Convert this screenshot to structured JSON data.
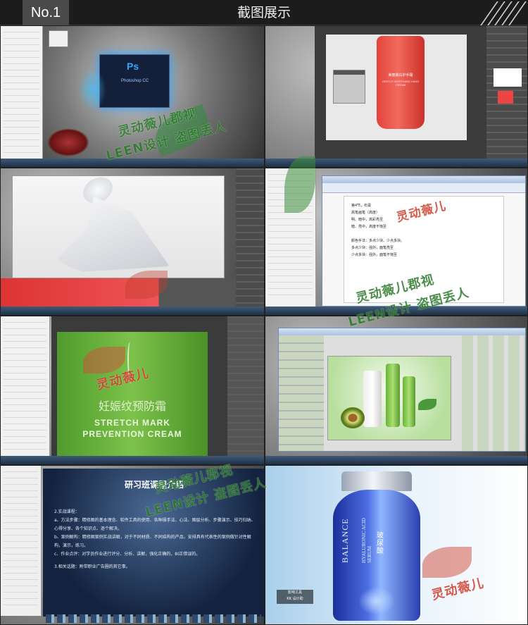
{
  "header": {
    "number_label": "No.1",
    "title": "截图展示"
  },
  "watermark": {
    "line1": "灵动薇儿郡视",
    "line2": "LEEN设计 盗图丢人",
    "short": "灵动薇儿"
  },
  "panels": {
    "ps_splash": {
      "logo": "Ps",
      "product": "Photoshop CC"
    },
    "tube": {
      "text_cn": "美丽嫩白护手霜",
      "text_en": "GENTLE WHITENING HAND CREAM"
    },
    "document": {
      "lines": [
        "第4节，石膏",
        "高笔画笔（高度）",
        "明、暗中，高彩亮至",
        "暗、亮中，高度不饱至",
        "",
        "颜色手法：多点少块、少点多块。",
        "多点少块：强外，面笔亮至",
        "少点多块：强外，面笔不饱至"
      ]
    },
    "green_bottle": {
      "text_cn": "妊娠纹预防霜",
      "text_en_1": "STRETCH MARK",
      "text_en_2": "PREVENTION CREAM"
    },
    "slide": {
      "title": "研习班课程介绍",
      "items": [
        "2.实战课程：",
        "a、方法步骤：精修图的基本理念、软件工具的使用、各种操手法、心法、图层分析、步骤演示、技巧归纳、心得分享、各个知识点、逐个解决。",
        "b、案例解构：精修图案例实战讲解，对于不同材质、不同结构的产品，安排具有代表性的案例做针对性解构，演示，练习。",
        "c、作业点评：对学员作业进行评分、分析、讲解，强化正确的，纠正错误的。",
        "3.相关话题：附带职业广告圈的其它事。"
      ]
    },
    "serum": {
      "brand": "BALANCE",
      "text_en": "HYALURONIC ACID SERUM",
      "text_cn": "玻尿酸",
      "small_1": "影响工具",
      "small_2": "KK 设计助"
    }
  },
  "colors": {
    "accent_green": "#2c7a2c",
    "accent_red": "#d23b2b",
    "header_bg": "#1c1c1c"
  }
}
